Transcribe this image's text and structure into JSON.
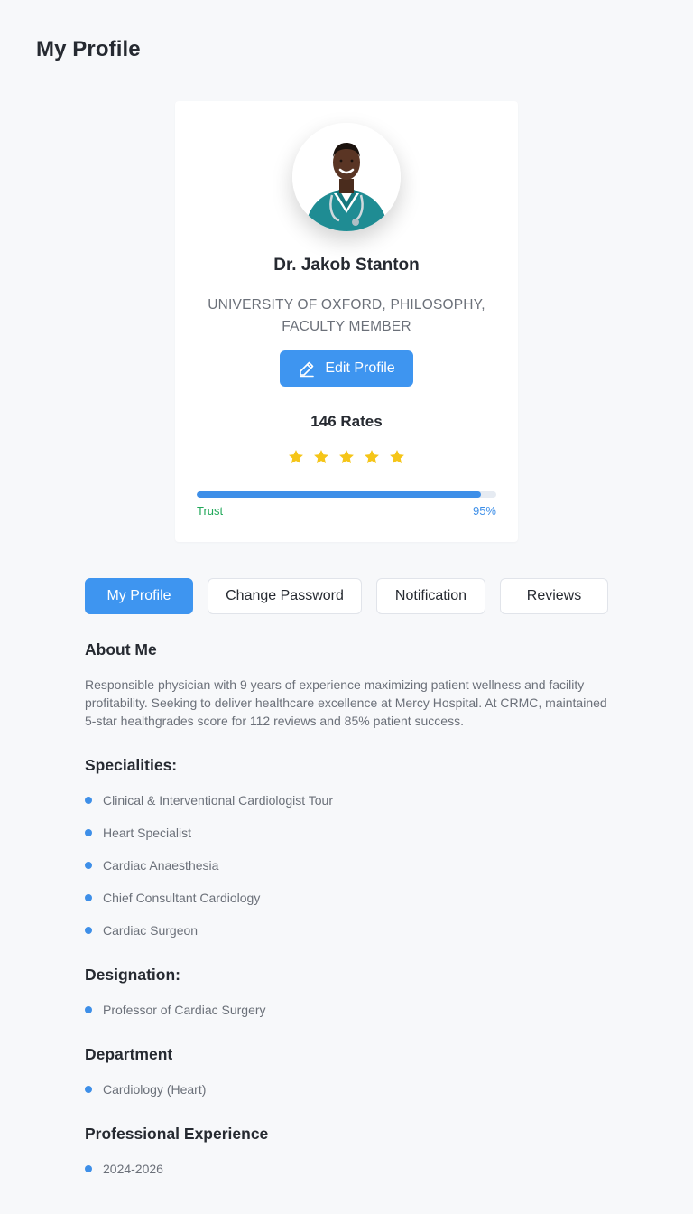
{
  "page": {
    "title": "My Profile"
  },
  "profile": {
    "name": "Dr. Jakob Stanton",
    "affiliation": "UNIVERSITY OF OXFORD, PHILOSOPHY, FACULTY MEMBER",
    "edit_label": "Edit Profile",
    "rates_label": "146 Rates",
    "rating_stars": 5,
    "trust_label": "Trust",
    "trust_value": "95%",
    "trust_percent": 95
  },
  "tabs": [
    {
      "label": "My Profile",
      "active": true
    },
    {
      "label": "Change Password",
      "active": false
    },
    {
      "label": "Notification",
      "active": false
    },
    {
      "label": "Reviews",
      "active": false
    }
  ],
  "about": {
    "title": "About Me",
    "text": "Responsible physician with 9 years of experience maximizing patient wellness and facility profitability. Seeking to deliver healthcare excellence at Mercy Hospital. At CRMC, maintained 5-star healthgrades score for 112 reviews and 85% patient success."
  },
  "specialities": {
    "title": "Specialities:",
    "items": [
      "Clinical & Interventional Cardiologist  Tour",
      "Heart Specialist",
      "Cardiac Anaesthesia",
      "Chief Consultant Cardiology",
      "Cardiac Surgeon"
    ]
  },
  "designation": {
    "title": "Designation:",
    "items": [
      "Professor of Cardiac Surgery"
    ]
  },
  "department": {
    "title": "Department",
    "items": [
      "Cardiology (Heart)"
    ]
  },
  "experience": {
    "title": "Professional Experience",
    "items": [
      "2024-2026"
    ]
  },
  "colors": {
    "accent": "#3e95f0",
    "star": "#f5c518",
    "trust_label": "#22a85a",
    "background": "#f7f8fa"
  },
  "icons": {
    "edit": "pencil-icon",
    "star": "star-icon",
    "bullet": "dot-icon"
  }
}
